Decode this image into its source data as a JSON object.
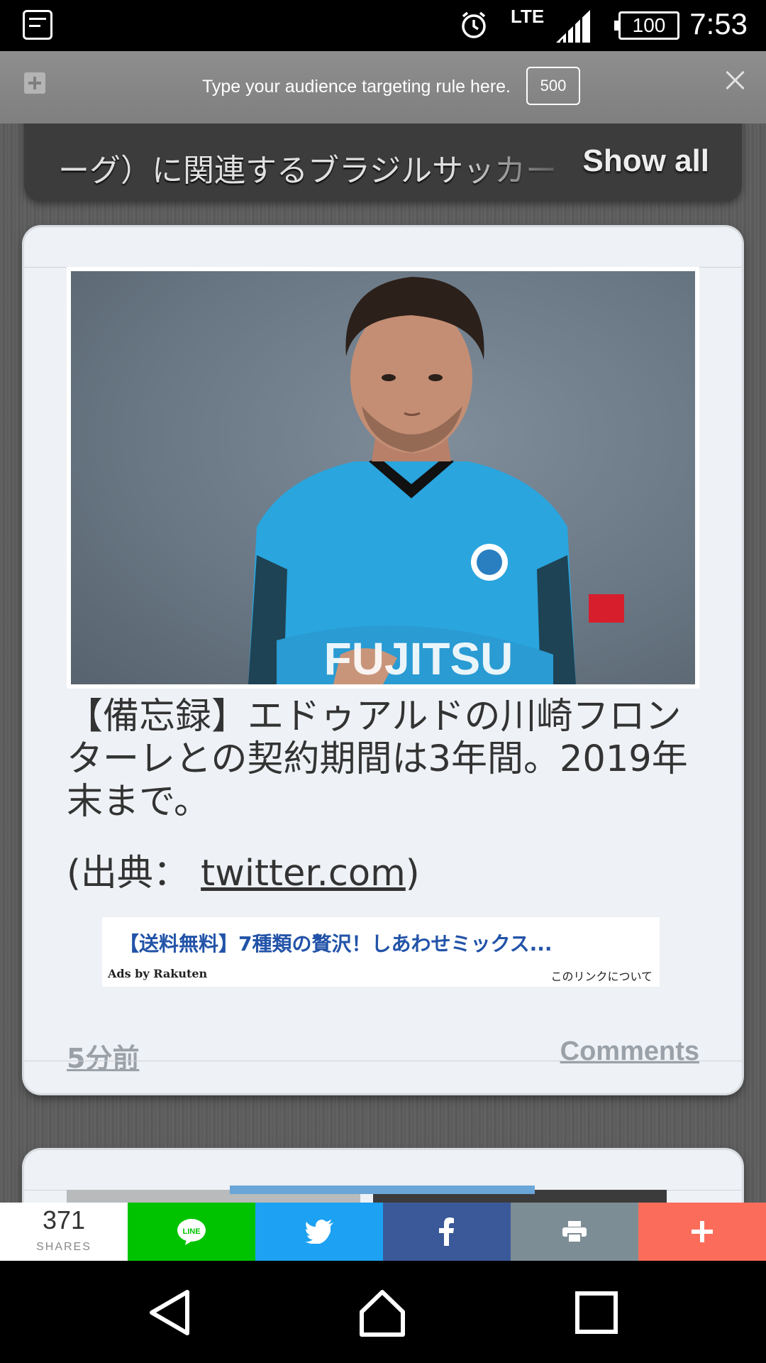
{
  "status_bar": {
    "network": "LTE",
    "battery": "100",
    "time": "7:53"
  },
  "targeting_bar": {
    "placeholder": "Type your audience targeting rule here.",
    "limit": "500"
  },
  "topic_panel": {
    "text": "ーグ）に関連するブラジルサッカー",
    "show_all": "Show all"
  },
  "article": {
    "title": "【備忘録】エドゥアルドの川崎フロンターレとの契約期間は3年間。2019年末まで。",
    "source_prefix": "(出典：",
    "source_link": "twitter.com",
    "source_suffix": ")",
    "time_ago": "5分前",
    "comments": "Comments"
  },
  "ad": {
    "headline": "【送料無料】7種類の贅沢！しあわせミックス...",
    "credit": "Ads by Rakuten",
    "about": "このリンクについて"
  },
  "share_bar": {
    "count": "371",
    "label": "SHARES",
    "line_label": "LINE",
    "colors": {
      "line": "#00c300",
      "twitter": "#1da1f2",
      "facebook": "#3b5998",
      "print": "#7d8d95",
      "more": "#fb6d5a"
    }
  },
  "icons": {
    "status": [
      "app-icon",
      "alarm-icon",
      "signal-icon",
      "battery-icon"
    ],
    "share": [
      "line-icon",
      "twitter-icon",
      "facebook-icon",
      "print-icon",
      "plus-icon"
    ],
    "nav": [
      "back-icon",
      "home-icon",
      "recents-icon"
    ]
  }
}
